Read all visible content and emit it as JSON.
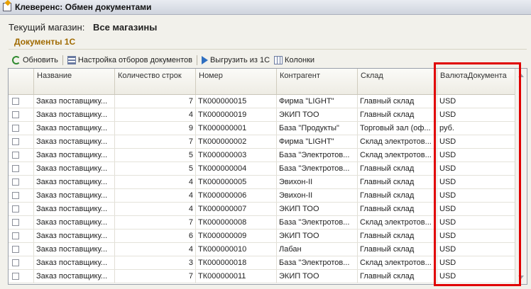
{
  "window": {
    "title": "Клеверенс: Обмен документами"
  },
  "store": {
    "label": "Текущий магазин:",
    "value": "Все магазины"
  },
  "section": {
    "title": "Документы 1С"
  },
  "toolbar": {
    "refresh": "Обновить",
    "filter_settings": "Настройка отборов документов",
    "export": "Выгрузить из 1С",
    "columns": "Колонки"
  },
  "table": {
    "columns": [
      "Название",
      "Количество строк",
      "Номер",
      "Контрагент",
      "Склад",
      "ВалютаДокумента"
    ],
    "rows": [
      [
        "Заказ поставщику...",
        "7",
        "ТК000000015",
        "Фирма \"LIGHT\"",
        "Главный склад",
        "USD"
      ],
      [
        "Заказ поставщику...",
        "4",
        "ТК000000019",
        "ЭКИП ТОО",
        "Главный склад",
        "USD"
      ],
      [
        "Заказ поставщику...",
        "9",
        "ТК000000001",
        "База \"Продукты\"",
        "Торговый зал (оф...",
        "руб."
      ],
      [
        "Заказ поставщику...",
        "7",
        "ТК000000002",
        "Фирма \"LIGHT\"",
        "Склад электротов...",
        "USD"
      ],
      [
        "Заказ поставщику...",
        "5",
        "ТК000000003",
        "База \"Электротов...",
        "Склад электротов...",
        "USD"
      ],
      [
        "Заказ поставщику...",
        "5",
        "ТК000000004",
        "База \"Электротов...",
        "Главный склад",
        "USD"
      ],
      [
        "Заказ поставщику...",
        "4",
        "ТК000000005",
        "Эвихон-II",
        "Главный склад",
        "USD"
      ],
      [
        "Заказ поставщику...",
        "4",
        "ТК000000006",
        "Эвихон-II",
        "Главный склад",
        "USD"
      ],
      [
        "Заказ поставщику...",
        "4",
        "ТК000000007",
        "ЭКИП ТОО",
        "Главный склад",
        "USD"
      ],
      [
        "Заказ поставщику...",
        "7",
        "ТК000000008",
        "База \"Электротов...",
        "Склад электротов...",
        "USD"
      ],
      [
        "Заказ поставщику...",
        "6",
        "ТК000000009",
        "ЭКИП ТОО",
        "Главный склад",
        "USD"
      ],
      [
        "Заказ поставщику...",
        "4",
        "ТК000000010",
        "Лабан",
        "Главный склад",
        "USD"
      ],
      [
        "Заказ поставщику...",
        "3",
        "ТК000000018",
        "База \"Электротов...",
        "Склад электротов...",
        "USD"
      ],
      [
        "Заказ поставщику...",
        "7",
        "ТК000000011",
        "ЭКИП ТОО",
        "Главный склад",
        "USD"
      ]
    ]
  },
  "colors": {
    "highlight": "#e00000",
    "section_title": "#a06a00"
  }
}
